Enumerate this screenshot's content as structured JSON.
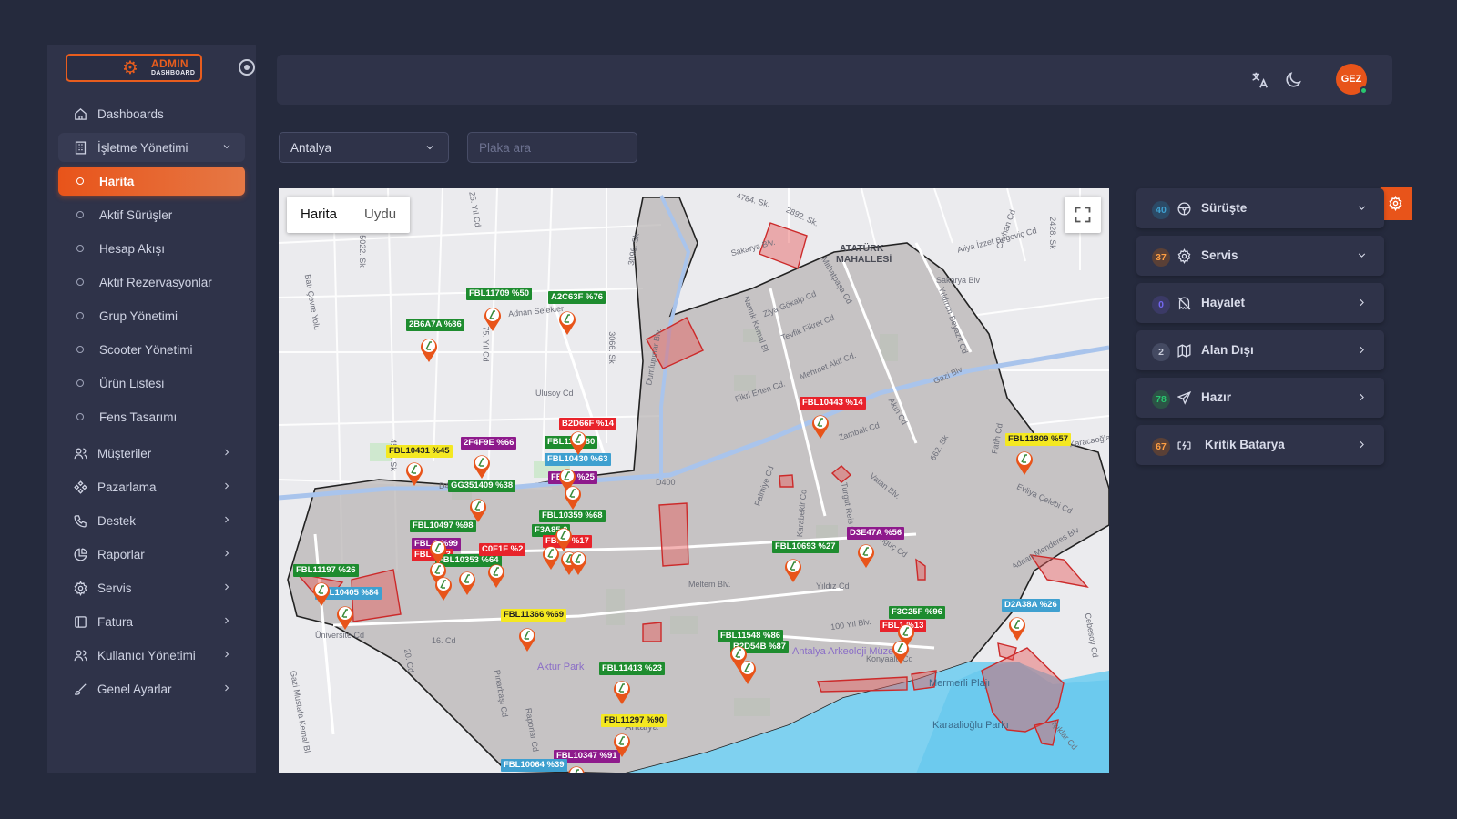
{
  "brand": {
    "logo_title": "ADMIN",
    "logo_subtitle": "DASHBOARD"
  },
  "sidebar": {
    "items": [
      {
        "label": "Dashboards",
        "icon": "home-icon"
      },
      {
        "label": "İşletme Yönetimi",
        "icon": "building-icon",
        "expanded": true
      },
      {
        "label": "Harita",
        "sub": true,
        "active": true
      },
      {
        "label": "Aktif Sürüşler",
        "sub": true
      },
      {
        "label": "Hesap Akışı",
        "sub": true
      },
      {
        "label": "Aktif Rezervasyonlar",
        "sub": true
      },
      {
        "label": "Grup Yönetimi",
        "sub": true
      },
      {
        "label": "Scooter Yönetimi",
        "sub": true
      },
      {
        "label": "Ürün Listesi",
        "sub": true
      },
      {
        "label": "Fens Tasarımı",
        "sub": true
      },
      {
        "label": "Müşteriler",
        "icon": "users-icon"
      },
      {
        "label": "Pazarlama",
        "icon": "marketing-icon"
      },
      {
        "label": "Destek",
        "icon": "phone-icon"
      },
      {
        "label": "Raporlar",
        "icon": "chart-pie-icon"
      },
      {
        "label": "Servis",
        "icon": "gear-icon"
      },
      {
        "label": "Fatura",
        "icon": "invoice-icon"
      },
      {
        "label": "Kullanıcı Yönetimi",
        "icon": "user-management-icon"
      },
      {
        "label": "Genel Ayarlar",
        "icon": "brush-icon"
      }
    ]
  },
  "topbar": {
    "avatar_text": "GEZ"
  },
  "filters": {
    "city": "Antalya",
    "plate_placeholder": "Plaka ara"
  },
  "map": {
    "tabs": [
      "Harita",
      "Uydu"
    ],
    "place_labels": {
      "ataturk": "ATATÜRK",
      "mahallesi": "MAHALLESİ",
      "aktur_park": "Aktur Park",
      "museum": "Antalya Arkeoloji Müzesi",
      "mermerli": "Mermerli Plajı",
      "karaalioglu": "Karaalioğlu Parkı",
      "antalya": "Antalya",
      "ataturk_bl": "Sakarya Blv.",
      "gazi": "Gazi Blv.",
      "meltem": "Meltem Blv.",
      "yildiz": "Yıldız Cd",
      "universite": "Üniversite Cd",
      "konyaalti": "Konyaaltı Cd",
      "100yil": "100 Yıl Blv.",
      "ulusoy": "Ulusoy Cd",
      "adnan": "Adnan Menderes Blv.",
      "zambak": "Zambak Cd",
      "vatan": "Vatan Blv.",
      "d400": "D400",
      "d400b": "D400",
      "evliya": "Evliya Çelebi Cd",
      "tonguc": "Tonguç Cd",
      "fikri": "Fikri Erten Cd.",
      "mehmet": "Mehmet Akif Cd.",
      "ziya": "Ziya Gökalp Cd",
      "tevfik": "Tevfik Fikret Cd",
      "aliya": "Aliya İzzet Begoviç Cd",
      "sakarya2": "Sakarya Blv",
      "sk4784": "4784. Sk.",
      "sk2892": "2892. Sk.",
      "sk5022": "5022. Sk",
      "sk4509": "4509. Sk",
      "sk3096": "3096. Sk",
      "sk3066": "3066. Sk",
      "sk2428": "2428. Sk",
      "sk662": "662. Sk",
      "yil75": "75. Yıl Cd",
      "yil25": "25. Yıl Cd",
      "dumlupinar": "Dumlupınar Blv.",
      "bati": "Batı Çevre Yolu",
      "cumhuriyet": "16. Cd",
      "cd20": "20. Cd",
      "gazi_m": "Gazi Mustafa Kemal Bl",
      "pinarbasi": "Pınarbaşı Cd",
      "raporlar_cd": "Raporlar Cd",
      "palmiye": "Palmiye Cd",
      "karabekir": "Karabekir Cd",
      "turgut": "Turgut Reis Cd",
      "fatih": "Fatih Cd",
      "yildirim": "Yıldırım Beyazıt Cd",
      "ceyhan": "Ceyhan Cd",
      "isiklar": "Işıklar Cd",
      "cebesoy": "Cebesoy Cd",
      "mithat": "Mithatpaşa Cd",
      "namik": "Namık Kemal Bl",
      "akin": "Akın Cd",
      "karacaoglan": "Karacaoğlan",
      "adnan2": "Adnan Selekler"
    },
    "vehicle_tags": [
      {
        "text": "FBL11709 %50",
        "color": "g"
      },
      {
        "text": "A2C63F %76",
        "color": "g"
      },
      {
        "text": "2B6A7A %86",
        "color": "g"
      },
      {
        "text": "B2D66F %14",
        "color": "r"
      },
      {
        "text": "FBL1177  80",
        "color": "g"
      },
      {
        "text": "FBL10430 %63",
        "color": "b"
      },
      {
        "text": "FBL    3 %25",
        "color": "p"
      },
      {
        "text": "FBL10443 %14",
        "color": "r"
      },
      {
        "text": "FBL11809 %57",
        "color": "y"
      },
      {
        "text": "FBL10431 %45",
        "color": "y"
      },
      {
        "text": "2F4F9E %66",
        "color": "p"
      },
      {
        "text": "GG351409 %38",
        "color": "g"
      },
      {
        "text": "FBL10359 %68",
        "color": "g"
      },
      {
        "text": "F3A85   0",
        "color": "g"
      },
      {
        "text": "FBL10497 %98",
        "color": "g"
      },
      {
        "text": "FBL   0 %99",
        "color": "p"
      },
      {
        "text": "FBL  %13",
        "color": "r"
      },
      {
        "text": "FBL10353 %64",
        "color": "g"
      },
      {
        "text": "C0F1F %2",
        "color": "r"
      },
      {
        "text": "FBL   8 %17",
        "color": "r"
      },
      {
        "text": "FBL11197 %26",
        "color": "g"
      },
      {
        "text": "FBL10405 %84",
        "color": "b"
      },
      {
        "text": "FBL10693 %27",
        "color": "g"
      },
      {
        "text": "D3E47A %56",
        "color": "p"
      },
      {
        "text": "F3C25F %96",
        "color": "g"
      },
      {
        "text": "FBL1  %13",
        "color": "r"
      },
      {
        "text": "D2A38A %26",
        "color": "b"
      },
      {
        "text": "FBL11366 %69",
        "color": "y"
      },
      {
        "text": "FBL11548 %86",
        "color": "g"
      },
      {
        "text": "B2D54B %87",
        "color": "g"
      },
      {
        "text": "FBL11413 %23",
        "color": "g"
      },
      {
        "text": "FBL11297 %90",
        "color": "y"
      },
      {
        "text": "FBL10347 %91",
        "color": "p"
      },
      {
        "text": "FBL10064 %39",
        "color": "b"
      }
    ]
  },
  "status_panel": [
    {
      "count": "40",
      "label": "Sürüşte",
      "icon": "steering-wheel-icon",
      "badge_color": "#3fa0d0",
      "badge_bg": "#2c4a66",
      "chevron": "down"
    },
    {
      "count": "37",
      "label": "Servis",
      "icon": "gear-icon",
      "badge_color": "#ff9f43",
      "badge_bg": "#5a4036",
      "chevron": "down"
    },
    {
      "count": "0",
      "label": "Hayalet",
      "icon": "ghost-off-icon",
      "badge_color": "#7367f0",
      "badge_bg": "#3b3a66",
      "chevron": "right"
    },
    {
      "count": "2",
      "label": "Alan Dışı",
      "icon": "map-icon",
      "badge_color": "#c6cad8",
      "badge_bg": "#444a62",
      "chevron": "right"
    },
    {
      "count": "78",
      "label": "Hazır",
      "icon": "send-icon",
      "badge_color": "#28c76f",
      "badge_bg": "#2c5446",
      "chevron": "right"
    },
    {
      "count": "67",
      "label": "Kritik Batarya",
      "icon": "battery-charging-icon",
      "badge_color": "#ff9f43",
      "badge_bg": "#5a4036",
      "chevron": "right"
    }
  ]
}
